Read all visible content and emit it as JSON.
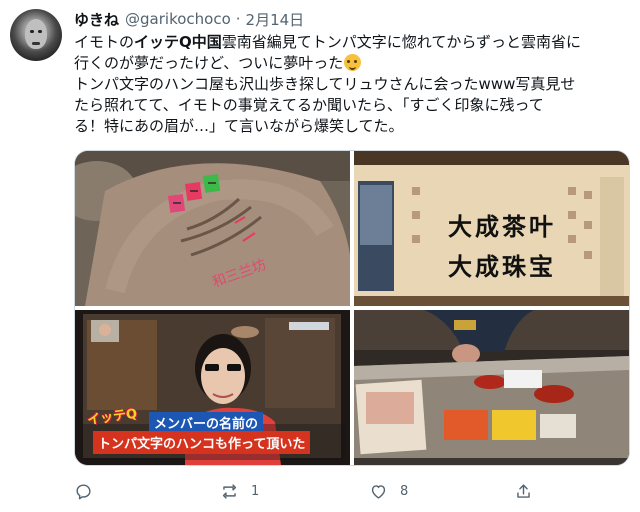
{
  "tweet": {
    "author_name": "ゆきね",
    "handle": "@garikochoco",
    "separator": "·",
    "date": "2月14日",
    "body": {
      "line1_a": "イモトの",
      "line1_bold": "イッテQ中国",
      "line1_b": "雲南省編見てトンパ文字に惚れてからずっと雲南省に",
      "line2": "行くのが夢だったけど、ついに夢叶った",
      "line3": "トンパ文字のハンコ屋も沢山歩き探してリュウさんに会ったwww写真見せ",
      "line4": "たら照れてて、イモトの事覚えてるか聞いたら、「すごく印象に残って",
      "line5": "る！特にあの眉が…」て言いながら爆笑してた。"
    },
    "emoji": "smiling-face-with-hearts"
  },
  "media": {
    "photo1": {
      "sign_text": "和三兰坊"
    },
    "photo2": {
      "sign_line1": "大成茶叶",
      "sign_line2": "大成珠宝"
    },
    "photo3": {
      "caption_line1": "メンバーの名前の",
      "caption_line2": "トンパ文字のハンコも作って頂いた",
      "logo": "イッテQ"
    },
    "photo4": {}
  },
  "actions": {
    "reply": {
      "icon": "reply-icon",
      "count": ""
    },
    "retweet": {
      "icon": "retweet-icon",
      "count": "1"
    },
    "like": {
      "icon": "heart-icon",
      "count": "8"
    },
    "share": {
      "icon": "share-icon",
      "count": ""
    }
  },
  "colors": {
    "text": "#0f1419",
    "secondary": "#536471",
    "border": "#cfd9de"
  }
}
